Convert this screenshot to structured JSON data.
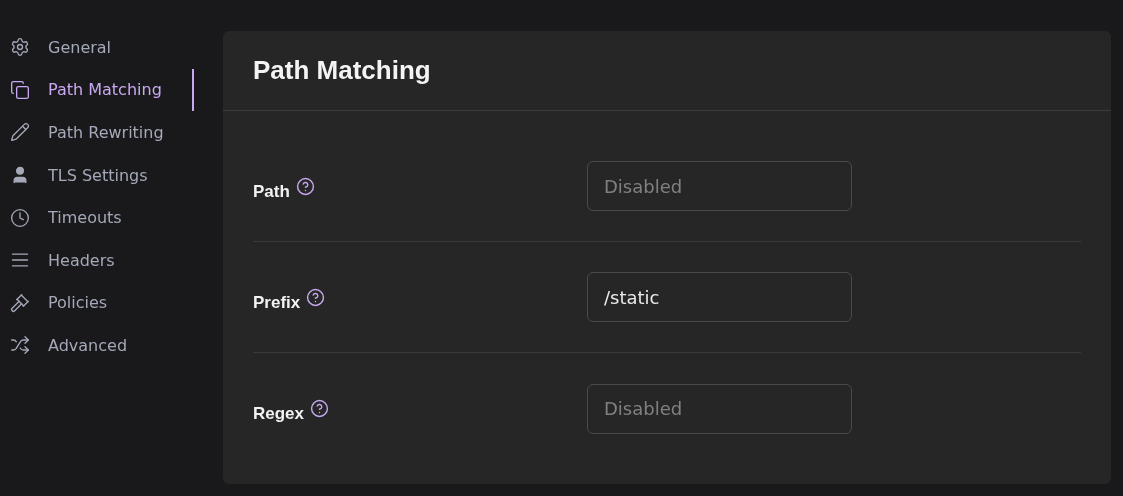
{
  "sidebar": {
    "items": [
      {
        "label": "General",
        "selected": false
      },
      {
        "label": "Path Matching",
        "selected": true
      },
      {
        "label": "Path Rewriting",
        "selected": false
      },
      {
        "label": "TLS Settings",
        "selected": false
      },
      {
        "label": "Timeouts",
        "selected": false
      },
      {
        "label": "Headers",
        "selected": false
      },
      {
        "label": "Policies",
        "selected": false
      },
      {
        "label": "Advanced",
        "selected": false
      }
    ]
  },
  "panel": {
    "title": "Path Matching",
    "fields": [
      {
        "label": "Path",
        "placeholder": "Disabled"
      },
      {
        "label": "Prefix",
        "value": "/static"
      },
      {
        "label": "Regex",
        "placeholder": "Disabled"
      }
    ]
  }
}
